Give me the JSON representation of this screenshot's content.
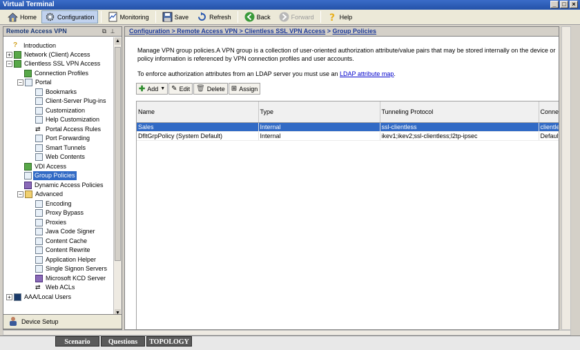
{
  "window": {
    "title": "Virtual Terminal"
  },
  "toolbar": {
    "home": "Home",
    "configuration": "Configuration",
    "monitoring": "Monitoring",
    "save": "Save",
    "refresh": "Refresh",
    "back": "Back",
    "forward": "Forward",
    "help": "Help"
  },
  "left_panel": {
    "title": "Remote Access VPN",
    "tree": [
      "Introduction",
      "Network (Client) Access",
      "Clientless SSL VPN Access",
      "Connection Profiles",
      "Portal",
      "Bookmarks",
      "Client-Server Plug-ins",
      "Customization",
      "Help Customization",
      "Portal Access Rules",
      "Port Forwarding",
      "Smart Tunnels",
      "Web Contents",
      "VDI Access",
      "Group Policies",
      "Dynamic Access Policies",
      "Advanced",
      "Encoding",
      "Proxy Bypass",
      "Proxies",
      "Java Code Signer",
      "Content Cache",
      "Content Rewrite",
      "Application Helper",
      "Single Signon Servers",
      "Microsoft KCD Server",
      "Web ACLs",
      "AAA/Local Users"
    ],
    "device_setup": "Device Setup"
  },
  "breadcrumb": {
    "part1": "Configuration > Remote Access VPN > Clientless SSL VPN Access",
    "sep": " > ",
    "part2": "Group Policies"
  },
  "main": {
    "desc_line1": "Manage VPN group policies.A VPN group is a collection of user-oriented authorization attribute/value pairs that may be stored internally on the device or",
    "desc_line2": "policy information is referenced by VPN connection profiles and user accounts.",
    "ldap_text": "To enforce authorization attributes from an LDAP server you must use an ",
    "ldap_link": "LDAP attribute map",
    "ldap_end": "."
  },
  "actions": {
    "add": "Add",
    "edit": "Edit",
    "delete": "Delete",
    "assign": "Assign"
  },
  "table": {
    "headers": [
      "Name",
      "Type",
      "Tunneling Protocol",
      "Connec"
    ],
    "rows": [
      [
        "Sales",
        "Internal",
        "ssl-clientless",
        "clientles"
      ],
      [
        "DfltGrpPolicy (System Default)",
        "Internal",
        "ikev1;ikev2;ssl-clientless;l2tp-ipsec",
        "DefaultR"
      ]
    ]
  },
  "bottom": {
    "scenario": "Scenario",
    "questions": "Questions",
    "topology": "TOPOLOGY"
  }
}
